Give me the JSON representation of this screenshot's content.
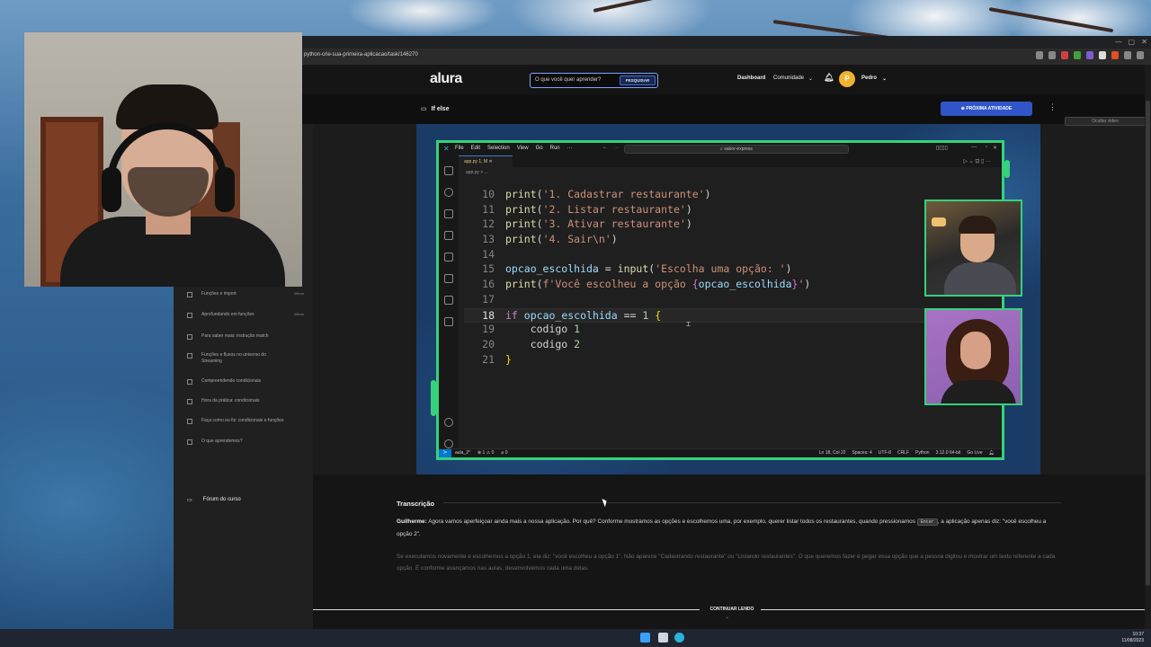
{
  "browser": {
    "url": "python-crie-sua-primeira-aplicacao/task/146270"
  },
  "site": {
    "logo": "alura",
    "search_placeholder": "O que você quer aprender?",
    "search_button": "PESQUISAR",
    "nav_dashboard": "Dashboard",
    "nav_comunidade": "Comunidade",
    "avatar_letter": "P",
    "user_name": "Pedro"
  },
  "lesson": {
    "title": "If else",
    "next_button": "PRÓXIMA ATIVIDADE",
    "hide_video": "Ocultar video"
  },
  "sidebar": {
    "items": [
      {
        "label": "Funções e import",
        "time": "08min"
      },
      {
        "label": "Aprofundando em funções",
        "time": "08min"
      },
      {
        "label": "Para saber mais: instrução match",
        "time": ""
      },
      {
        "label": "Funções e fluxos no universo do Streaming",
        "time": ""
      },
      {
        "label": "Compreendendo condicionais",
        "time": ""
      },
      {
        "label": "Hora da prática: condicionais",
        "time": ""
      },
      {
        "label": "Faça como eu fiz: condicionais e funções",
        "time": ""
      },
      {
        "label": "O que aprendemos?",
        "time": ""
      }
    ],
    "forum": "Fórum do curso"
  },
  "vscode": {
    "menu": [
      "File",
      "Edit",
      "Selection",
      "View",
      "Go",
      "Run",
      "···"
    ],
    "search": "sabor-express",
    "tab": "app.py  1, M",
    "breadcrumb": "app.py > ...",
    "lines": [
      {
        "n": "10",
        "html": "<span class='fn'>print</span>(<span class='str'>'1. Cadastrar restaurante'</span>)"
      },
      {
        "n": "11",
        "html": "<span class='fn'>print</span>(<span class='str'>'2. Listar restaurante'</span>)"
      },
      {
        "n": "12",
        "html": "<span class='fn'>print</span>(<span class='str'>'3. Ativar restaurante'</span>)"
      },
      {
        "n": "13",
        "html": "<span class='fn'>print</span>(<span class='str'>'4. Sair\\n'</span>)"
      },
      {
        "n": "14",
        "html": ""
      },
      {
        "n": "15",
        "html": "<span class='var'>opcao_escolhida</span> = <span class='fn'>input</span>(<span class='str'>'Escolha uma opção: '</span>)"
      },
      {
        "n": "16",
        "html": "<span class='fn'>print</span>(<span class='str'>f'Você escolheu a opção </span><span class='br2'>{</span><span class='var'>opcao_escolhida</span><span class='br2'>}</span><span class='str'>'</span>)"
      },
      {
        "n": "17",
        "html": ""
      },
      {
        "n": "18",
        "html": "<span class='kw'>if</span> <span class='var'>opcao_escolhida</span> == <span class='num'>1</span> <span class='br'>{</span>"
      },
      {
        "n": "19",
        "html": "    codigo <span class='num'>1</span>"
      },
      {
        "n": "20",
        "html": "    codigo <span class='num'>2</span>"
      },
      {
        "n": "21",
        "html": "<span class='br'>}</span>"
      }
    ],
    "status_left": [
      "aula_2*",
      "⊗ 1 ⚠ 0",
      "⌀ 0"
    ],
    "status_right": [
      "Ln 18, Col 22",
      "Spaces: 4",
      "UTF-8",
      "CRLF",
      "Python",
      "3.12.0 64-bit",
      "Go Live"
    ]
  },
  "transcript": {
    "title": "Transcrição",
    "speaker": "Guilherme:",
    "p1_a": "Agora vamos aperfeiçoar ainda mais a nossa aplicação. Por quê? Conforme mostramos as opções e escolhemos uma, por exemplo, querer listar todos os restaurantes, quando pressionamos",
    "p1_key": "Enter",
    "p1_b": ", a aplicação apenas diz: \"você escolheu a opção 2\".",
    "p2": "Se executamos novamente e escolhemos a opção 1, ela diz: \"você escolheu a opção 1\". Não aparece \"Cadastrando restaurante\" ou \"Listando restaurantes\". O que queremos fazer é pegar essa opção que a pessoa digitou e mostrar um texto referente a cada opção. É conforme avançamos nas aulas, desenvolvemos cada uma delas.",
    "continue": "CONTINUAR LENDO"
  },
  "taskbar": {
    "time": "10:37",
    "date": "11/08/2023"
  },
  "colors": {
    "accent_green": "#35d27b",
    "alura_blue": "#2f55c8"
  }
}
